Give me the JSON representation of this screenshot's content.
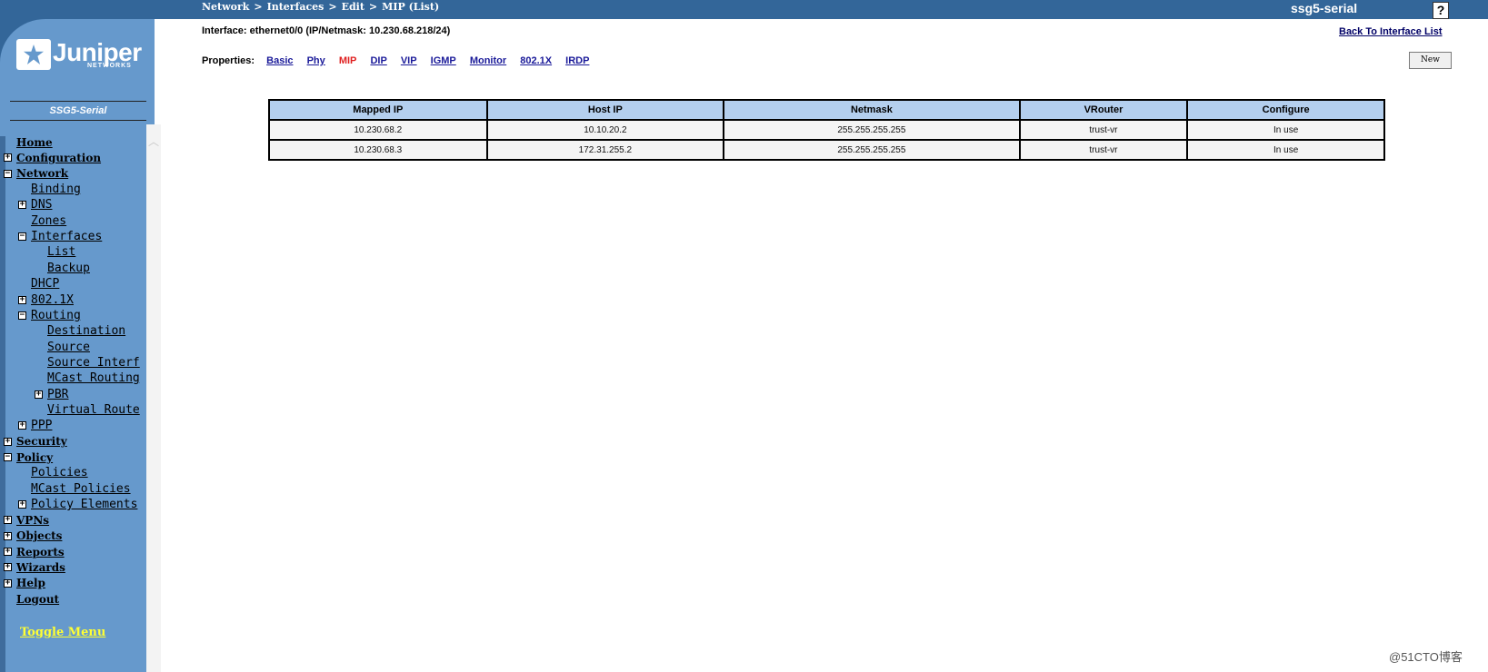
{
  "header": {
    "breadcrumb": [
      "Network",
      "Interfaces",
      "Edit",
      "MIP (List)"
    ],
    "device_name": "ssg5-serial",
    "help_label": "?"
  },
  "sidebar": {
    "logo_text": "Juniper",
    "logo_subtext": "NETWORKS",
    "model": "SSG5-Serial",
    "toggle_menu": "Toggle Menu",
    "nav": [
      {
        "label": "Home",
        "level": 0,
        "toggle": ""
      },
      {
        "label": "Configuration",
        "level": 0,
        "toggle": "+"
      },
      {
        "label": "Network",
        "level": 0,
        "toggle": "-"
      },
      {
        "label": "Binding",
        "level": 1,
        "toggle": ""
      },
      {
        "label": "DNS",
        "level": 1,
        "toggle": "+"
      },
      {
        "label": "Zones",
        "level": 1,
        "toggle": ""
      },
      {
        "label": "Interfaces",
        "level": 1,
        "toggle": "-"
      },
      {
        "label": "List",
        "level": 2,
        "toggle": ""
      },
      {
        "label": "Backup",
        "level": 2,
        "toggle": ""
      },
      {
        "label": "DHCP",
        "level": 1,
        "toggle": ""
      },
      {
        "label": "802.1X",
        "level": 1,
        "toggle": "+"
      },
      {
        "label": "Routing",
        "level": 1,
        "toggle": "-"
      },
      {
        "label": "Destination",
        "level": 2,
        "toggle": ""
      },
      {
        "label": "Source",
        "level": 2,
        "toggle": ""
      },
      {
        "label": "Source Interf",
        "level": 2,
        "toggle": ""
      },
      {
        "label": "MCast Routing",
        "level": 2,
        "toggle": ""
      },
      {
        "label": "PBR",
        "level": 2,
        "toggle": "+"
      },
      {
        "label": "Virtual Route",
        "level": 2,
        "toggle": ""
      },
      {
        "label": "PPP",
        "level": 1,
        "toggle": "+"
      },
      {
        "label": "Security",
        "level": 0,
        "toggle": "+"
      },
      {
        "label": "Policy",
        "level": 0,
        "toggle": "-"
      },
      {
        "label": "Policies",
        "level": 1,
        "toggle": ""
      },
      {
        "label": "MCast Policies",
        "level": 1,
        "toggle": ""
      },
      {
        "label": "Policy Elements",
        "level": 1,
        "toggle": "+"
      },
      {
        "label": "VPNs",
        "level": 0,
        "toggle": "+"
      },
      {
        "label": "Objects",
        "level": 0,
        "toggle": "+"
      },
      {
        "label": "Reports",
        "level": 0,
        "toggle": "+"
      },
      {
        "label": "Wizards",
        "level": 0,
        "toggle": "+"
      },
      {
        "label": "Help",
        "level": 0,
        "toggle": "+"
      },
      {
        "label": "Logout",
        "level": 0,
        "toggle": ""
      }
    ]
  },
  "main": {
    "interface_info": "Interface: ethernet0/0 (IP/Netmask: 10.230.68.218/24)",
    "back_link": "Back To Interface List",
    "properties_label": "Properties:",
    "tabs": [
      "Basic",
      "Phy",
      "MIP",
      "DIP",
      "VIP",
      "IGMP",
      "Monitor",
      "802.1X",
      "IRDP"
    ],
    "active_tab": "MIP",
    "new_button": "New",
    "table": {
      "headers": [
        "Mapped IP",
        "Host IP",
        "Netmask",
        "VRouter",
        "Configure"
      ],
      "rows": [
        [
          "10.230.68.2",
          "10.10.20.2",
          "255.255.255.255",
          "trust-vr",
          "In use"
        ],
        [
          "10.230.68.3",
          "172.31.255.2",
          "255.255.255.255",
          "trust-vr",
          "In use"
        ]
      ]
    }
  },
  "watermark": "@51CTO博客",
  "colors": {
    "topbar": "#336699",
    "sidebar": "#6699cc",
    "table_header": "#b4cfee",
    "active_tab": "#e02020",
    "toggle_menu": "#ffff33"
  }
}
